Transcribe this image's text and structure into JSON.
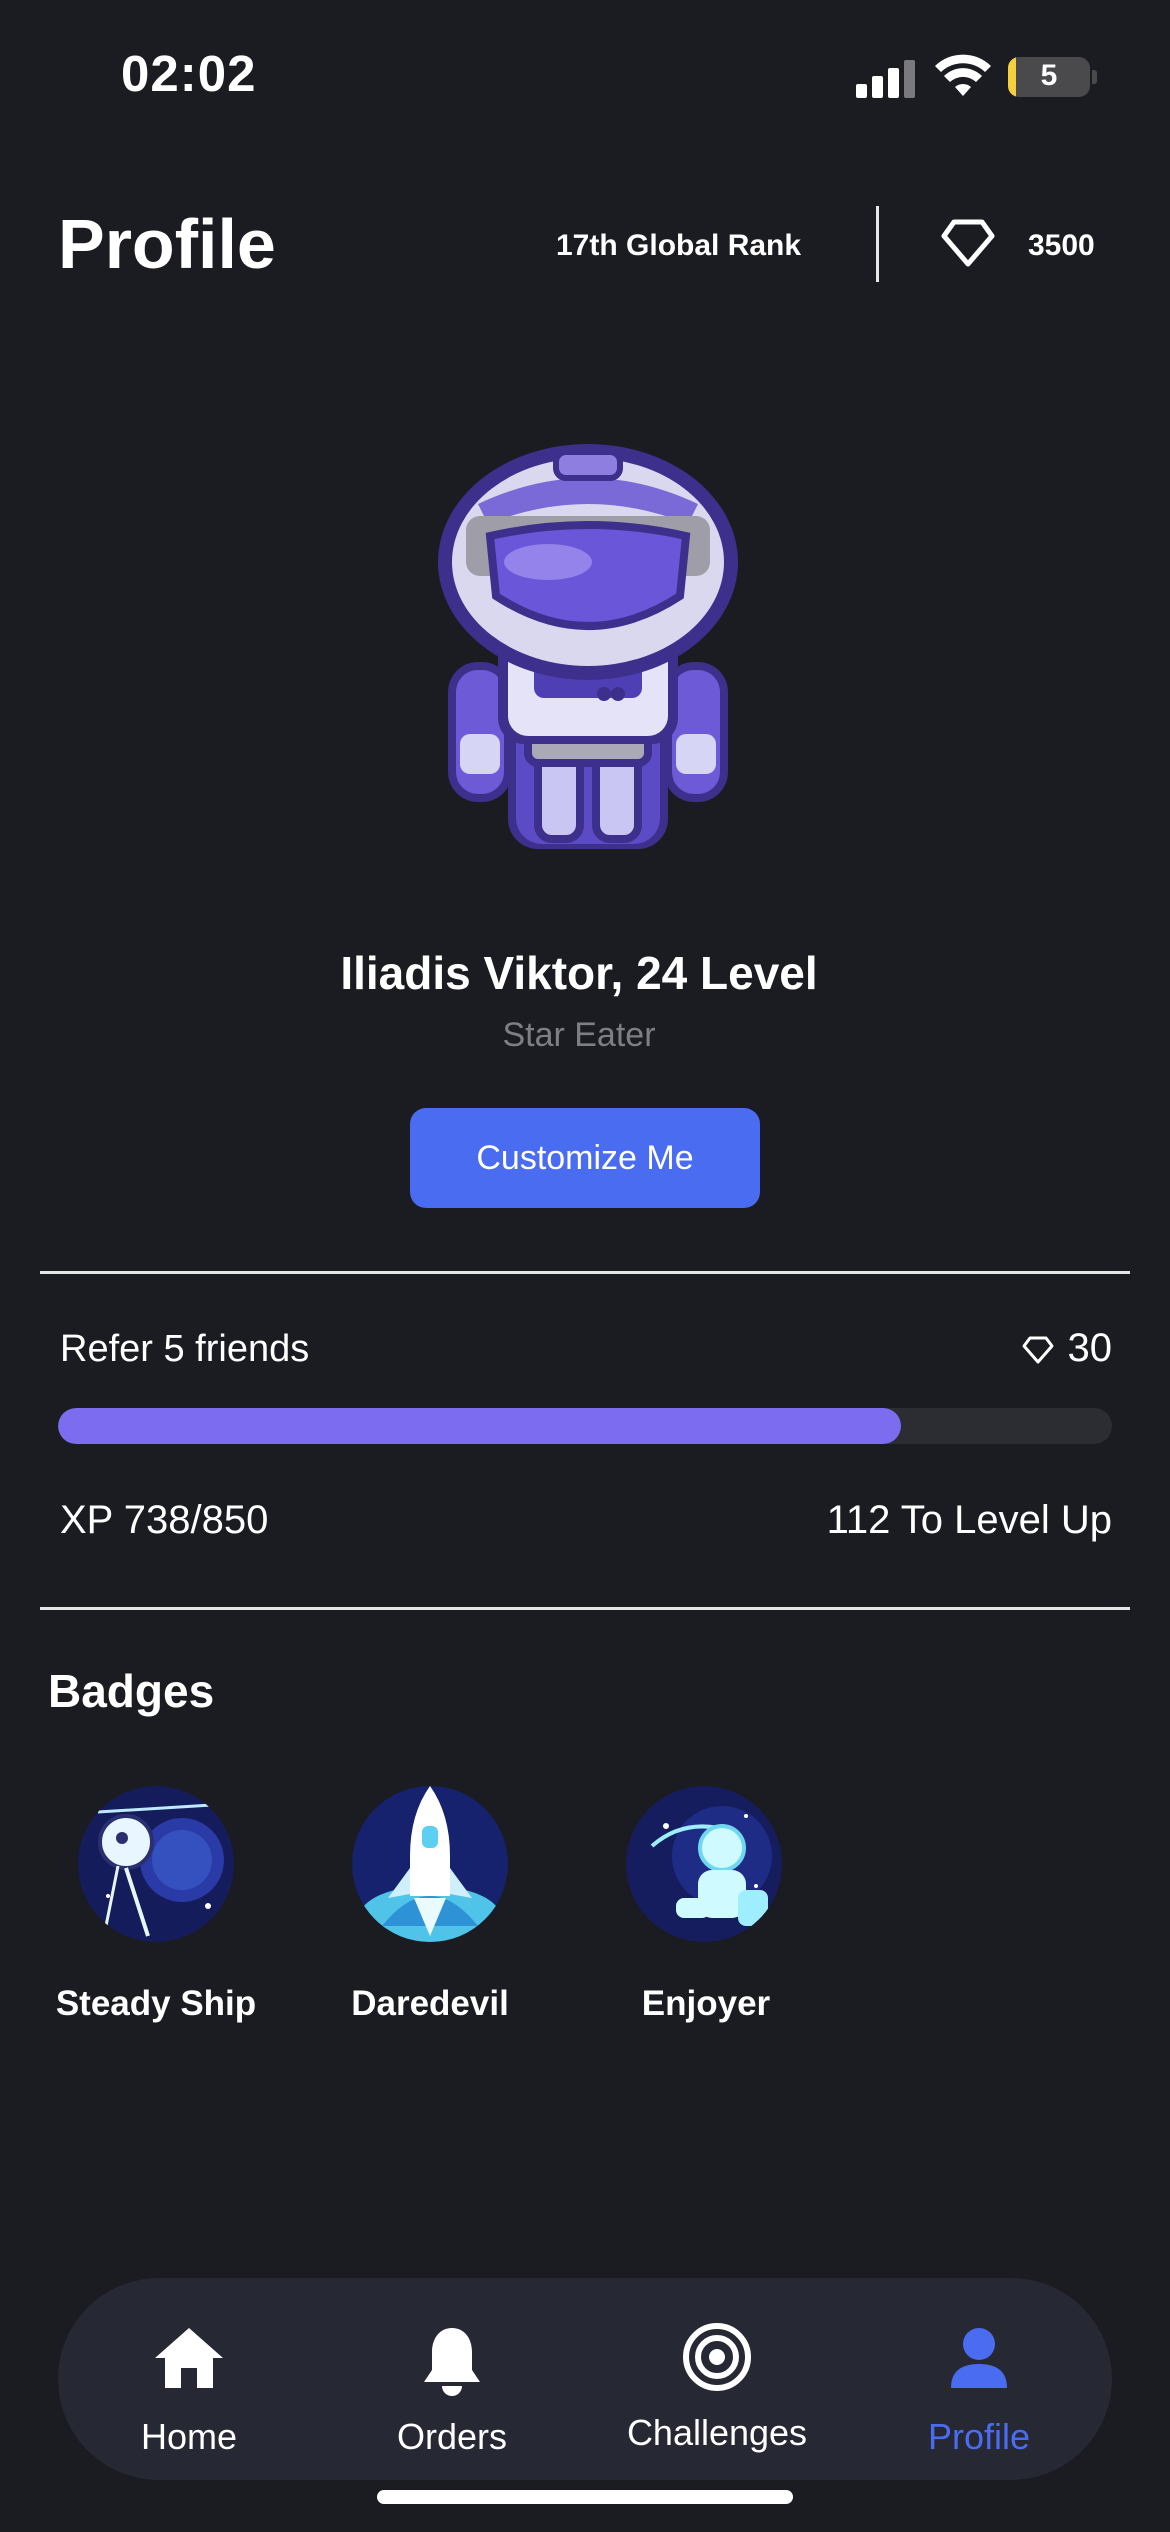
{
  "status_bar": {
    "time": "02:02",
    "battery": "5"
  },
  "header": {
    "title": "Profile",
    "rank": "17th Global Rank",
    "gems": "3500"
  },
  "profile": {
    "name": "Iliadis Viktor, 24 Level",
    "subtitle": "Star Eater",
    "customize_label": "Customize Me"
  },
  "challenge": {
    "task": "Refer 5 friends",
    "reward": "30",
    "progress_fraction": 0.8
  },
  "xp": {
    "current": "XP 738/850",
    "remaining": "112 To Level Up"
  },
  "badges": {
    "title": "Badges",
    "items": [
      {
        "label": "Steady Ship",
        "icon": "satellite-icon"
      },
      {
        "label": "Daredevil",
        "icon": "rocket-icon"
      },
      {
        "label": "Enjoyer",
        "icon": "astronaut-icon"
      }
    ]
  },
  "nav": {
    "items": [
      {
        "label": "Home",
        "icon": "home-icon"
      },
      {
        "label": "Orders",
        "icon": "bell-icon"
      },
      {
        "label": "Challenges",
        "icon": "target-icon"
      },
      {
        "label": "Profile",
        "icon": "person-icon"
      }
    ]
  },
  "colors": {
    "background": "#1b1c21",
    "accent": "#4a6cf0",
    "progress": "#7b6cf0",
    "active_nav": "#4a6cf0",
    "nav_bg": "#262834"
  }
}
